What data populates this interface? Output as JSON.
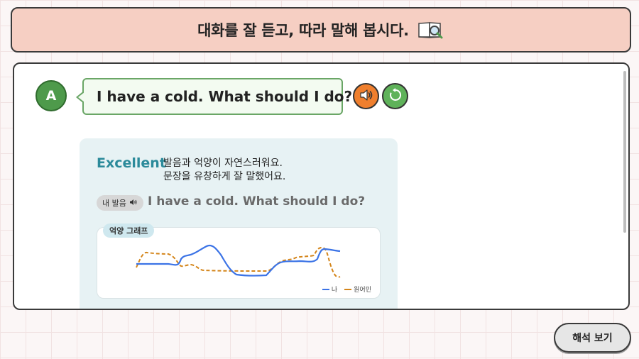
{
  "header": {
    "title": "대화를 잘 듣고, 따라 말해 봅시다.",
    "icon": "book-magnifier-icon"
  },
  "dialogue": {
    "speaker": "A",
    "sentence": "I have a cold. What should I do?",
    "speaker_color": "#4e9a4b"
  },
  "controls": {
    "play_icon": "speaker-icon",
    "replay_icon": "replay-icon"
  },
  "feedback": {
    "grade": "Excellent",
    "comment_line1": "발음과 억양이 자연스러워요.",
    "comment_line2": "문장을 유창하게 잘 말했어요.",
    "my_pronunciation_label": "내 발음",
    "my_pronunciation_text": "I have a cold. What should I do?",
    "graph_label": "억양 그래프",
    "legend_me": "나",
    "legend_native": "원어민"
  },
  "colors": {
    "accent_orange": "#ef7f2e",
    "accent_green": "#5fb25a",
    "grade_teal": "#2b8a9a",
    "line_me": "#3b73e6",
    "line_native": "#d4851a"
  },
  "footer": {
    "translate_button": "해석 보기"
  }
}
